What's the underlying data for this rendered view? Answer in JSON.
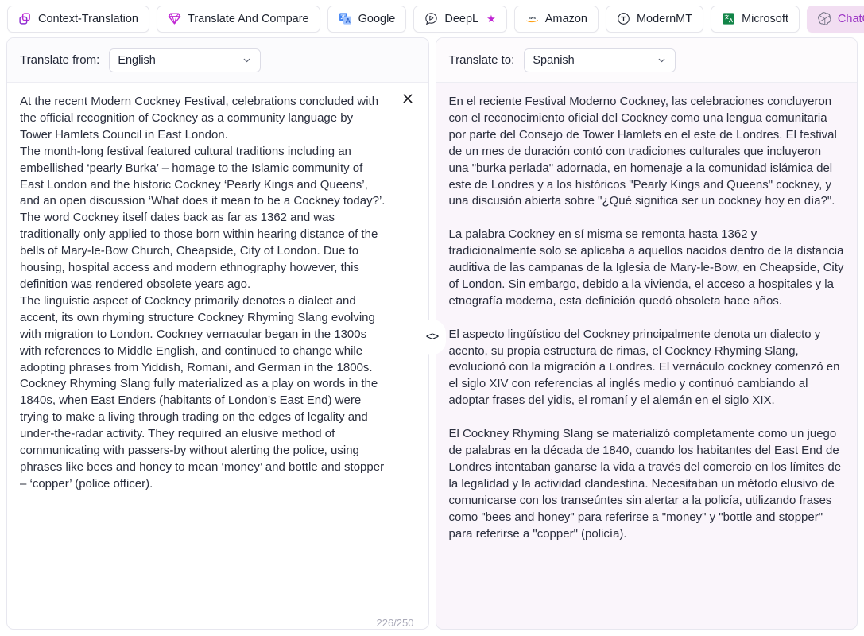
{
  "tabs": [
    {
      "id": "context-translation",
      "label": "Context-Translation",
      "icon": "copy-icon",
      "active": false,
      "starred": false
    },
    {
      "id": "translate-and-compare",
      "label": "Translate And Compare",
      "icon": "diamond-icon",
      "active": false,
      "starred": false
    },
    {
      "id": "google",
      "label": "Google",
      "icon": "google-translate-icon",
      "active": false,
      "starred": false
    },
    {
      "id": "deepl",
      "label": "DeepL",
      "icon": "deepl-icon",
      "active": false,
      "starred": true
    },
    {
      "id": "amazon",
      "label": "Amazon",
      "icon": "aws-icon",
      "active": false,
      "starred": false
    },
    {
      "id": "modernmt",
      "label": "ModernMT",
      "icon": "modernmt-icon",
      "active": false,
      "starred": false
    },
    {
      "id": "microsoft",
      "label": "Microsoft",
      "icon": "microsoft-translator-icon",
      "active": false,
      "starred": false
    },
    {
      "id": "chatgpt",
      "label": "ChatGPT",
      "icon": "openai-icon",
      "active": true,
      "starred": false
    }
  ],
  "source": {
    "lang_label": "Translate from:",
    "lang_value": "English",
    "counter": "226/250",
    "clear_icon": "close-icon",
    "paragraphs": [
      "At the recent Modern Cockney Festival, celebrations concluded with the official recognition of Cockney as a community language by Tower Hamlets Council in East London.",
      "The month-long festival featured cultural traditions including an embellished ‘pearly Burka’ – homage to the Islamic community of East London and the historic Cockney ‘Pearly Kings and Queens’, and an open discussion ‘What does it mean to be a Cockney today?’.",
      "The word Cockney itself dates back as far as 1362 and was traditionally only applied to those born within hearing distance of the bells of Mary-le-Bow Church, Cheapside, City of London. Due to housing, hospital access and modern ethnography however, this definition was rendered obsolete years ago.",
      "The linguistic aspect of Cockney primarily denotes a dialect and accent, its own rhyming structure Cockney Rhyming Slang evolving with migration to London. Cockney vernacular began in the 1300s with references to Middle English, and continued to change while adopting phrases from Yiddish, Romani, and German in the 1800s.",
      "Cockney Rhyming Slang fully materialized as a play on words in the 1840s, when East Enders (habitants of London’s East End) were trying to make a living through trading on the edges of legality and under-the-radar activity. They required an elusive method of communicating with passers-by without alerting the police, using phrases like bees and honey to mean ‘money’ and bottle and stopper – ‘copper’ (police officer)."
    ]
  },
  "target": {
    "lang_label": "Translate to:",
    "lang_value": "Spanish",
    "paragraphs": [
      "En el reciente Festival Moderno Cockney, las celebraciones concluyeron con el reconocimiento oficial del Cockney como una lengua comunitaria por parte del Consejo de Tower Hamlets en el este de Londres. El festival de un mes de duración contó con tradiciones culturales que incluyeron una \"burka perlada\" adornada, en homenaje a la comunidad islámica del este de Londres y a los históricos \"Pearly Kings and Queens\" cockney, y una discusión abierta sobre \"¿Qué significa ser un cockney hoy en día?\".",
      "La palabra Cockney en sí misma se remonta hasta 1362 y tradicionalmente solo se aplicaba a aquellos nacidos dentro de la distancia auditiva de las campanas de la Iglesia de Mary-le-Bow, en Cheapside, City of London. Sin embargo, debido a la vivienda, el acceso a hospitales y la etnografía moderna, esta definición quedó obsoleta hace años.",
      "El aspecto lingüístico del Cockney principalmente denota un dialecto y acento, su propia estructura de rimas, el Cockney Rhyming Slang, evolucionó con la migración a Londres. El vernáculo cockney comenzó en el siglo XIV con referencias al inglés medio y continuó cambiando al adoptar frases del yidis, el romaní y el alemán en el siglo XIX.",
      "El Cockney Rhyming Slang se materializó completamente como un juego de palabras en la década de 1840, cuando los habitantes del East End de Londres intentaban ganarse la vida a través del comercio en los límites de la legalidad y la actividad clandestina. Necesitaban un método elusivo de comunicarse con los transeúntes sin alertar a la policía, utilizando frases como \"bees and honey\" para referirse a \"money\" y \"bottle and stopper\" para referirse a \"copper\" (policía)."
    ]
  },
  "splitter": {
    "glyph": "<>",
    "name": "panel-resize-handle"
  },
  "colors": {
    "accent": "#9b35c4",
    "active_tab_bg": "#f2def2",
    "target_panel_bg": "#faf5fb",
    "star": "#c026d3",
    "text": "#2b2f3e",
    "muted": "#a9a9b8"
  }
}
